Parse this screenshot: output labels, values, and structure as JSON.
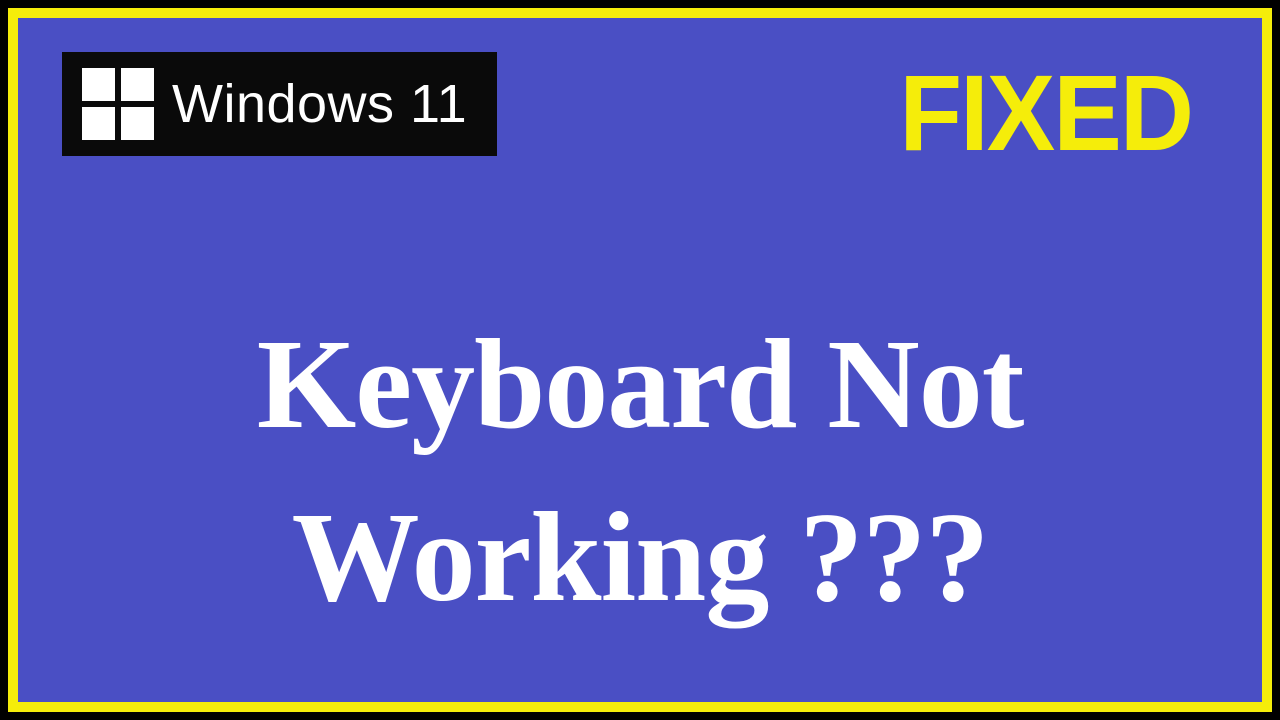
{
  "badge": {
    "label": "Windows 11"
  },
  "status": {
    "label": "FIXED"
  },
  "headline": {
    "line1": "Keyboard Not",
    "line2": "Working ???"
  }
}
